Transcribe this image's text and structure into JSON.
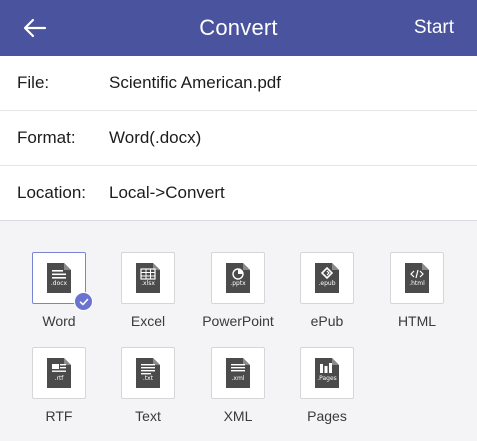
{
  "header": {
    "title": "Convert",
    "start_label": "Start",
    "back_icon": "arrow-left-icon"
  },
  "info": {
    "file_label": "File:",
    "file_value": "Scientific American.pdf",
    "format_label": "Format:",
    "format_value": "Word(.docx)",
    "location_label": "Location:",
    "location_value": "Local->Convert"
  },
  "formats": [
    {
      "label": "Word",
      "ext": ".docx",
      "icon": "word-doc-icon",
      "selected": true
    },
    {
      "label": "Excel",
      "ext": ".xlsx",
      "icon": "excel-doc-icon",
      "selected": false
    },
    {
      "label": "PowerPoint",
      "ext": ".pptx",
      "icon": "powerpoint-doc-icon",
      "selected": false
    },
    {
      "label": "ePub",
      "ext": ".epub",
      "icon": "epub-doc-icon",
      "selected": false
    },
    {
      "label": "HTML",
      "ext": ".html",
      "icon": "html-doc-icon",
      "selected": false
    },
    {
      "label": "RTF",
      "ext": ".rtf",
      "icon": "rtf-doc-icon",
      "selected": false
    },
    {
      "label": "Text",
      "ext": ".txt",
      "icon": "text-doc-icon",
      "selected": false
    },
    {
      "label": "XML",
      "ext": ".xml",
      "icon": "xml-doc-icon",
      "selected": false
    },
    {
      "label": "Pages",
      "ext": ".Pages",
      "icon": "pages-doc-icon",
      "selected": false
    }
  ],
  "colors": {
    "header_bg": "#4a539e",
    "accent": "#6a74cf",
    "doc_icon": "#4b4b4b"
  }
}
